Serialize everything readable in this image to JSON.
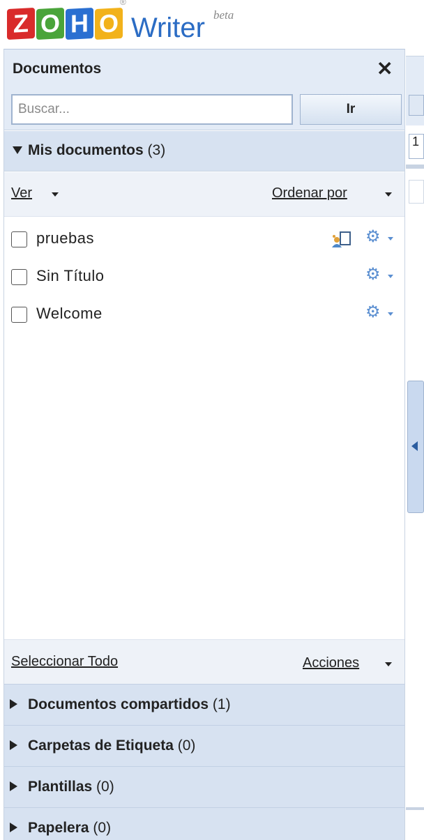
{
  "header": {
    "logo_letters": [
      "Z",
      "O",
      "H",
      "O"
    ],
    "registered_mark": "®",
    "app_name": "Writer",
    "beta_label": "beta"
  },
  "panel": {
    "title": "Documentos",
    "close_icon": "close-icon",
    "search": {
      "value": "",
      "placeholder": "Buscar...",
      "button_label": "Ir"
    },
    "my_docs": {
      "label": "Mis documentos",
      "count": "(3)"
    },
    "toolbar": {
      "view_label": "Ver",
      "sort_label": "Ordenar por"
    },
    "documents": [
      {
        "name": "pruebas",
        "shared": true
      },
      {
        "name": "Sin Título",
        "shared": false
      },
      {
        "name": "Welcome",
        "shared": false
      }
    ],
    "footer": {
      "select_all_label": "Seleccionar Todo",
      "actions_label": "Acciones"
    },
    "sections": [
      {
        "label": "Documentos compartidos",
        "count": "(1)"
      },
      {
        "label": "Carpetas de Etiqueta",
        "count": "(0)"
      },
      {
        "label": "Plantillas",
        "count": "(0)"
      },
      {
        "label": "Papelera",
        "count": "(0)"
      }
    ]
  },
  "right_strip": {
    "field_value": "1"
  },
  "colors": {
    "panel_header_bg": "#e3ebf6",
    "section_bg": "#d7e2f1",
    "writer_blue": "#2b6cc4",
    "gear_blue": "#5b8fd1"
  }
}
